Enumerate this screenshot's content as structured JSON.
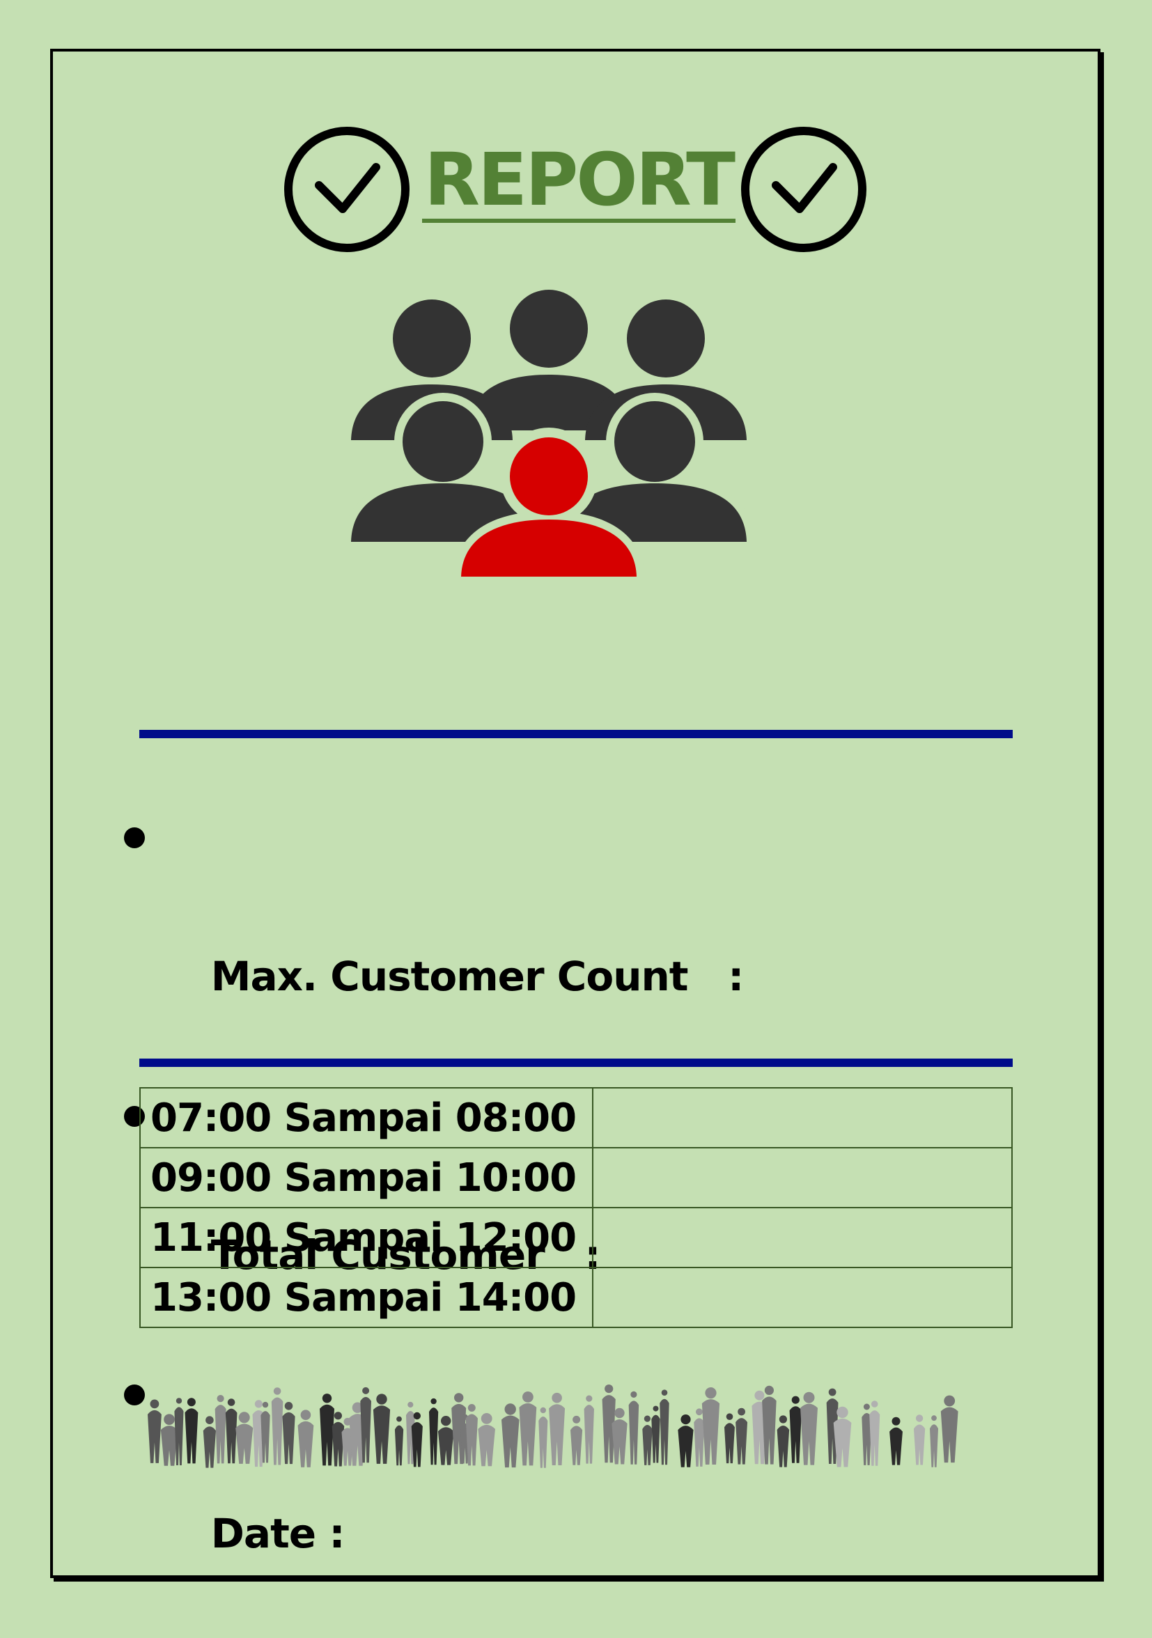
{
  "report": {
    "title": "REPORT",
    "info_items": [
      {
        "text": "Max. Customer Count   :"
      },
      {
        "text": "Total Customer   :"
      },
      {
        "text": "Date :"
      }
    ],
    "schedule": [
      {
        "time": "07:00 Sampai 08:00",
        "value": ""
      },
      {
        "time": "09:00 Sampai 10:00",
        "value": ""
      },
      {
        "time": "11:00 Sampai 12:00",
        "value": ""
      },
      {
        "time": "13:00 Sampai 14:00",
        "value": ""
      }
    ]
  },
  "icons": {
    "title_left": "check-circle-icon",
    "title_right": "check-circle-icon",
    "hero": "customer-group-icon",
    "footer": "crowd-silhouette-strip"
  },
  "colors": {
    "background": "#c5e0b3",
    "title": "#538135",
    "divider": "#000c8a",
    "highlight_person": "#d60000",
    "people": "#333333"
  }
}
